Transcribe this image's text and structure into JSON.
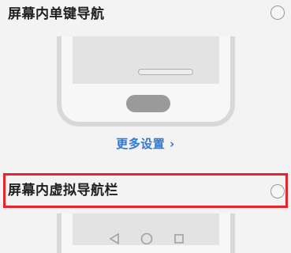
{
  "options": {
    "single_key": {
      "label": "屏幕内单键导航",
      "selected": false
    },
    "virtual_nav": {
      "label": "屏幕内虚拟导航栏",
      "selected": false
    }
  },
  "more_settings_label": "更多设置 ›",
  "colors": {
    "highlight": "#e8232c",
    "link": "#2f79d6"
  },
  "icons": {
    "nav_back": "back-triangle-icon",
    "nav_home": "home-circle-icon",
    "nav_recent": "recent-square-icon"
  }
}
